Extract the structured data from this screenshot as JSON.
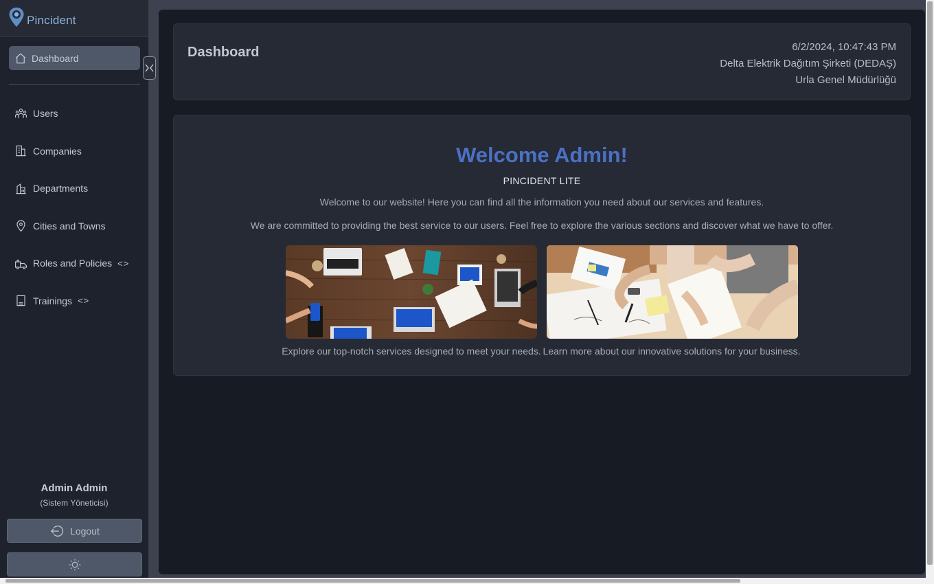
{
  "app": {
    "brand_name": "Pincident"
  },
  "sidebar": {
    "dashboard_label": "Dashboard",
    "items": [
      {
        "label": "Users",
        "icon": "users-icon",
        "expandable": false
      },
      {
        "label": "Companies",
        "icon": "building-icon",
        "expandable": false
      },
      {
        "label": "Departments",
        "icon": "department-icon",
        "expandable": false
      },
      {
        "label": "Cities and Towns",
        "icon": "map-pin-icon",
        "expandable": false
      },
      {
        "label": "Roles and Policies",
        "icon": "roles-icon",
        "expandable": true,
        "chevron": "<>"
      },
      {
        "label": "Trainings",
        "icon": "book-icon",
        "expandable": true,
        "chevron": "<>"
      }
    ],
    "user": {
      "name": "Admin Admin",
      "role": "(Sistem Yöneticisi)"
    },
    "logout_label": "Logout"
  },
  "header": {
    "title": "Dashboard",
    "datetime": "6/2/2024, 10:47:43 PM",
    "company": "Delta Elektrik Dağıtım Şirketi (DEDAŞ)",
    "department": "Urla Genel Müdürlüğü"
  },
  "welcome": {
    "title": "Welcome Admin!",
    "subtitle": "PINCIDENT LITE",
    "paragraph1": "Welcome to our website! Here you can find all the information you need about our services and features.",
    "paragraph2": "We are committed to providing the best service to our users. Feel free to explore the various sections and discover what we have to offer.",
    "cards": [
      {
        "caption": "Explore our top-notch services designed to meet your needs."
      },
      {
        "caption": "Learn more about our innovative solutions for your business."
      }
    ]
  },
  "colors": {
    "accent": "#4b70c4",
    "sidebar_bg": "#1e222c",
    "main_bg": "#171b24",
    "card_bg": "#262a35",
    "active_item_bg": "#4e5868"
  }
}
